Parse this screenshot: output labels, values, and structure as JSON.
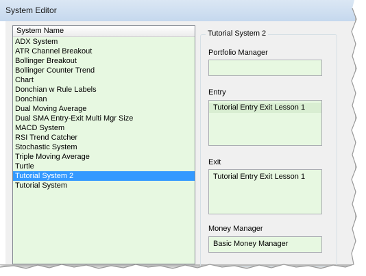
{
  "window": {
    "title": "System Editor"
  },
  "system_list": {
    "header": "System Name",
    "selected_index": 14,
    "items": [
      "ADX System",
      "ATR Channel Breakout",
      "Bollinger Breakout",
      "Bollinger Counter Trend",
      "Chart",
      "Donchian w Rule Labels",
      "Donchian",
      "Dual Moving Average",
      "Dual SMA Entry-Exit Multi Mgr Size",
      "MACD System",
      "RSI Trend Catcher",
      "Stochastic System",
      "Triple Moving Average",
      "Turtle",
      "Tutorial System 2",
      "Tutorial System"
    ]
  },
  "details": {
    "group_title": "Tutorial System 2",
    "portfolio_manager": {
      "label": "Portfolio Manager",
      "value": ""
    },
    "entry": {
      "label": "Entry",
      "value": "Tutorial Entry Exit Lesson 1"
    },
    "exit": {
      "label": "Exit",
      "value": "Tutorial Entry Exit Lesson 1"
    },
    "money_manager": {
      "label": "Money Manager",
      "value": "Basic Money Manager"
    }
  },
  "colors": {
    "list_background": "#e7f8e1",
    "selection": "#3399ff",
    "titlebar": "#c5d8ee",
    "client_background": "#f0f0f0"
  }
}
